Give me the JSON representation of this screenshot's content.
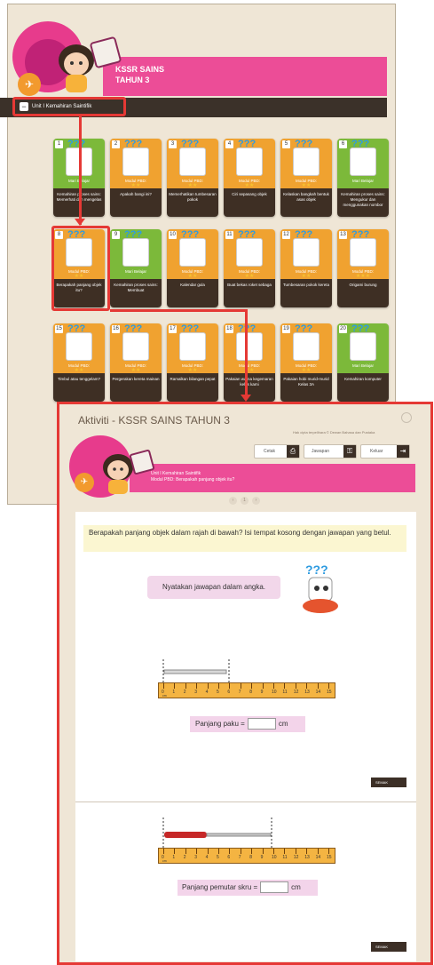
{
  "back_window": {
    "title_line1": "KSSR SAINS",
    "title_line2": "TAHUN 3",
    "unit_label": "Unit I Kemahiran Saintifik",
    "unit_toggle": "−",
    "cards": [
      {
        "num": "1",
        "type": "Mari Belajar",
        "stars": "",
        "title": "Kemahiran proses sains: Memerhati dan mengelas",
        "color": "#7cb93a"
      },
      {
        "num": "2",
        "type": "Modul PBD:",
        "stars": "★★",
        "title": "Apakah bangi ini?",
        "color": "#f0a230"
      },
      {
        "num": "3",
        "type": "Modul PBD:",
        "stars": "★★",
        "title": "Memerhatikan tumbesaran pokok",
        "color": "#f0a230"
      },
      {
        "num": "4",
        "type": "Modul PBD:",
        "stars": "★★",
        "title": "Ciri sepasang objek",
        "color": "#f0a230"
      },
      {
        "num": "5",
        "type": "Modul PBD:",
        "stars": "★★",
        "title": "Kelaskan bangkah bentuk asas objek",
        "color": "#f0a230"
      },
      {
        "num": "6",
        "type": "Mari Belajar",
        "stars": "",
        "title": "Kemahiran proses sains: Mengukur dan menggunakan nombor",
        "color": "#7cb93a"
      },
      {
        "num": "8",
        "type": "Modul PBD:",
        "stars": "★★",
        "title": "Berapakah panjang objek itu?",
        "color": "#f0a230"
      },
      {
        "num": "9",
        "type": "Mari Belajar",
        "stars": "",
        "title": "Kemahiran proses sains: Membuat",
        "color": "#7cb93a"
      },
      {
        "num": "10",
        "type": "Modul PBD:",
        "stars": "★★",
        "title": "Kalendar gula",
        "color": "#f0a230"
      },
      {
        "num": "11",
        "type": "Modul PBD:",
        "stars": "★★",
        "title": "Buat bekas roket sebaga",
        "color": "#f0a230"
      },
      {
        "num": "12",
        "type": "Modul PBD:",
        "stars": "★★",
        "title": "Tumbesaran pokok kereta",
        "color": "#f0a230"
      },
      {
        "num": "13",
        "type": "Modul PBD:",
        "stars": "★★★",
        "title": "Origami burung",
        "color": "#f0a230"
      },
      {
        "num": "15",
        "type": "Modul PBD:",
        "stars": "★★",
        "title": "Timbul atau tenggelam?",
        "color": "#f0a230"
      },
      {
        "num": "16",
        "type": "Modul PBD:",
        "stars": "★★",
        "title": "Pergerakan kereta mainan",
        "color": "#f0a230"
      },
      {
        "num": "17",
        "type": "Modul PBD:",
        "stars": "★★",
        "title": "Ramalkan bilangan pepat",
        "color": "#f0a230"
      },
      {
        "num": "18",
        "type": "Modul PBD:",
        "stars": "★★",
        "title": "Pakaian warna kegemaran kelas kami",
        "color": "#f0a230"
      },
      {
        "num": "19",
        "type": "Modul PBD:",
        "stars": "★★",
        "title": "Pakaian hobi murid-murid Kelas 3A",
        "color": "#f0a230"
      },
      {
        "num": "20",
        "type": "Mari Belajar",
        "stars": "",
        "title": "Kemahiran komputer",
        "color": "#7cb93a"
      }
    ]
  },
  "front_window": {
    "title": "Aktiviti - KSSR SAINS TAHUN 3",
    "subtitle": "Hak cipta terpelihara © Dewan Bahasa dan Pustaka",
    "btn_cetak": "Cetak",
    "btn_jawapan": "Jawapan",
    "btn_keluar": "Keluar",
    "unit": "Unit I Kemahiran Saintifik",
    "module": "Modul PBD: Berapakah panjang objek itu?",
    "pager": [
      "‹",
      "1",
      "›"
    ],
    "question": "Berapakah panjang objek dalam rajah di bawah? Isi tempat kosong dengan jawapan yang betul.",
    "bubble": "Nyatakan jawapan dalam angka.",
    "answer1_label": "Panjang paku =",
    "answer1_unit": "cm",
    "answer2_label": "Panjang pemutar skru =",
    "answer2_unit": "cm",
    "semak": "SEMAK",
    "ruler_unit": "cm",
    "ruler_numbers": [
      "0",
      "1",
      "2",
      "3",
      "4",
      "5",
      "6",
      "7",
      "8",
      "9",
      "10",
      "11",
      "12",
      "13",
      "14",
      "15"
    ]
  },
  "colors": {
    "pink": "#ec4d97",
    "dark": "#3b3129",
    "highlight": "#e53935",
    "cream": "#efe6d6"
  }
}
